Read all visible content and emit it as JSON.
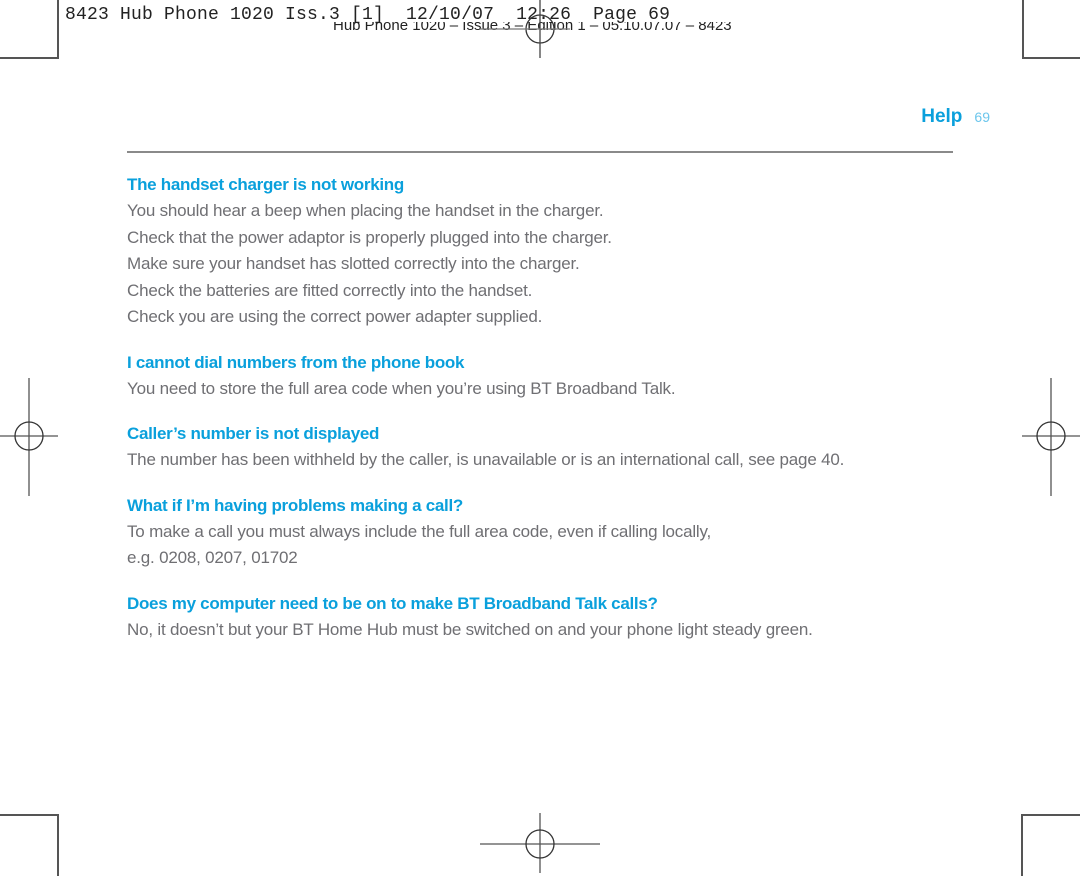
{
  "print_slug": {
    "job_line": "8423 Hub Phone 1020 Iss.3 [1]  12/10/07  12:26  Page 69",
    "edition_line": "Hub Phone 1020 – Issue 3 – Edition 1 – 05.10.07.07 – 8423"
  },
  "running_head": {
    "section": "Help",
    "page_number": "69"
  },
  "sections": [
    {
      "heading": "The handset charger is not working",
      "lines": [
        "You should hear a beep when placing the handset in the charger.",
        "Check that the power adaptor is properly plugged into the charger.",
        "Make sure your handset has slotted correctly into the charger.",
        "Check the batteries are fitted correctly into the handset.",
        "Check you are using the correct power adapter supplied."
      ]
    },
    {
      "heading": "I cannot dial numbers from the phone book",
      "lines": [
        "You need to store the full area code when you’re using BT Broadband Talk."
      ]
    },
    {
      "heading": "Caller’s number is not displayed",
      "lines": [
        "The number has been withheld by the caller, is unavailable or is an international call, see page 40."
      ]
    },
    {
      "heading": "What if I’m having problems making a call?",
      "lines": [
        "To make a call you must always include the full area code, even if calling locally,",
        "e.g. 0208, 0207, 01702"
      ]
    },
    {
      "heading": "Does my computer need to be on to make BT Broadband Talk calls?",
      "lines": [
        "No, it doesn’t but your BT Home Hub must be switched on and your phone light steady green."
      ]
    }
  ],
  "colors": {
    "heading": "#0aa0dc",
    "body_text": "#6f6f73",
    "rule": "#8a8a8a"
  }
}
